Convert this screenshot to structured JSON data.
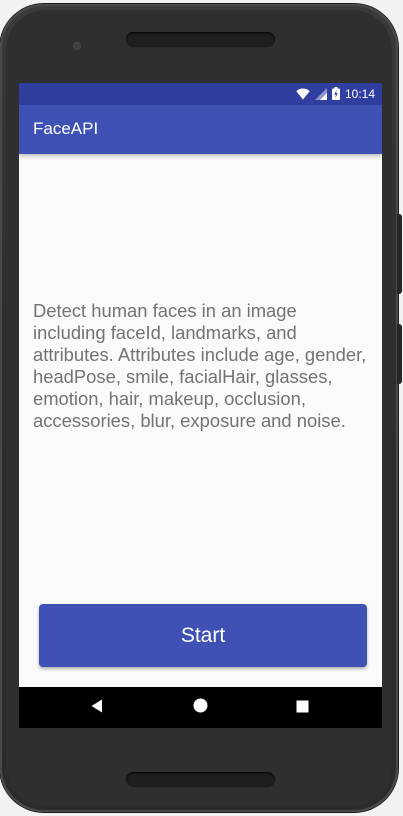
{
  "status_bar": {
    "time": "10:14",
    "icons": [
      "wifi-icon",
      "signal-icon",
      "battery-icon"
    ]
  },
  "app_bar": {
    "title": "FaceAPI"
  },
  "main": {
    "description": "Detect human faces in an image including faceId, landmarks, and attributes. Attributes include age, gender, headPose, smile, facialHair, glasses, emotion, hair, makeup, occlusion, accessories, blur, exposure and noise.",
    "start_label": "Start"
  },
  "nav_bar": {
    "buttons": [
      "back-icon",
      "home-icon",
      "recents-icon"
    ]
  },
  "colors": {
    "status_bar": "#303f9f",
    "app_bar": "#3f51b5",
    "button": "#3f51b5",
    "body_text": "#737373",
    "screen_background": "#fafafa"
  }
}
